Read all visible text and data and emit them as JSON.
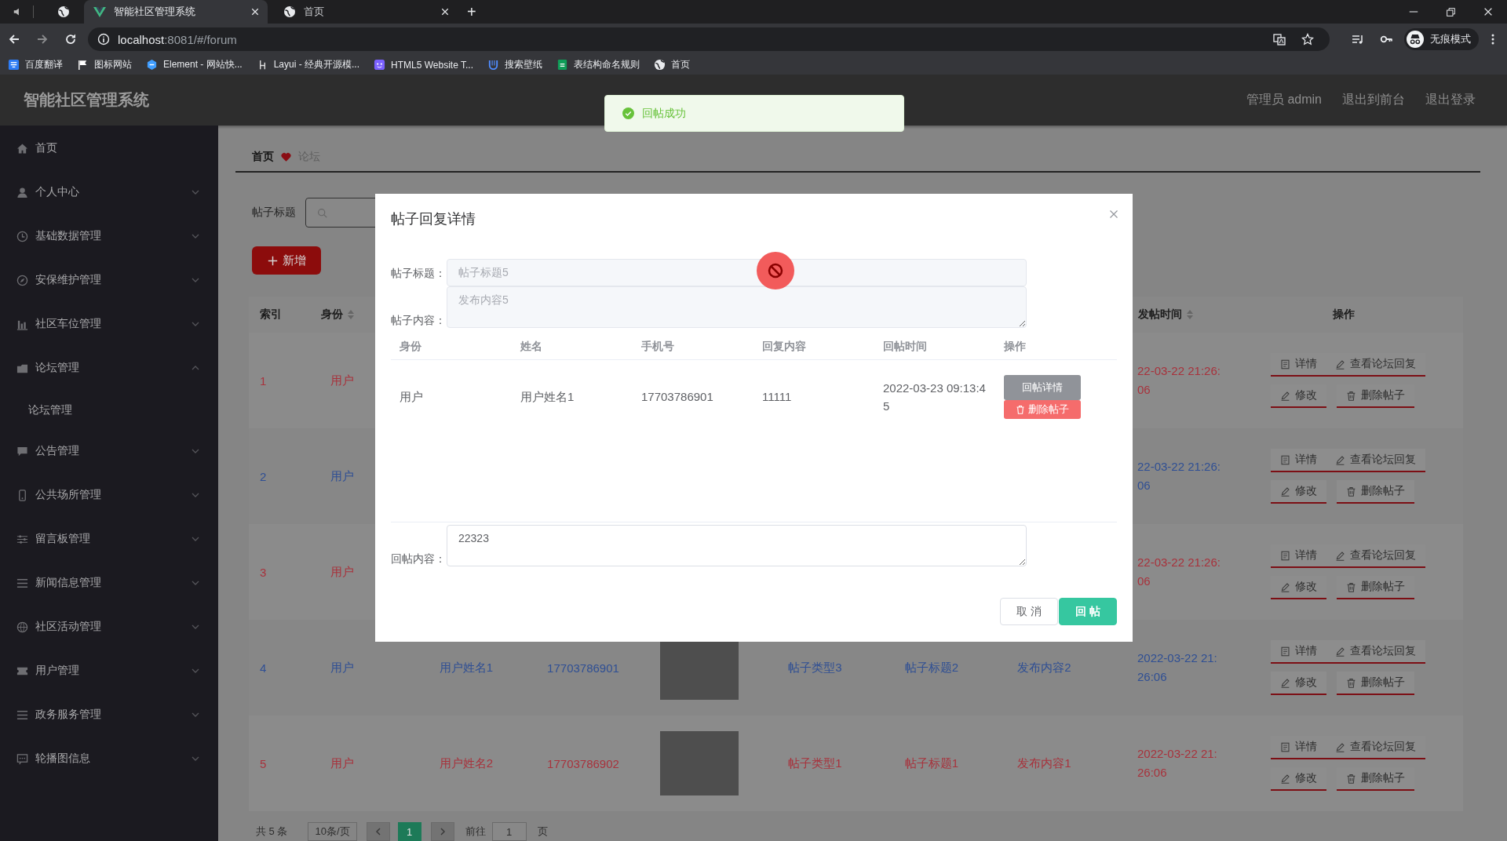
{
  "browser": {
    "tabs": [
      {
        "title": "智能社区管理系统",
        "selected": true
      },
      {
        "title": "首页",
        "selected": false
      }
    ],
    "new_tab": "+",
    "url": {
      "host": "localhost",
      "path": ":8081/#/forum"
    },
    "profile": "无痕模式",
    "bookmarks": [
      "百度翻译",
      "图标网站",
      "Element - 网站快...",
      "Layui - 经典开源模...",
      "HTML5 Website T...",
      "搜索壁纸",
      "表结构命名规则",
      "首页"
    ]
  },
  "header": {
    "title": "智能社区管理系统",
    "links": [
      "管理员 admin",
      "退出到前台",
      "退出登录"
    ]
  },
  "toast": {
    "message": "回帖成功"
  },
  "sidebar": {
    "items": [
      {
        "label": "首页"
      },
      {
        "label": "个人中心",
        "expanded": false
      },
      {
        "label": "基础数据管理",
        "expanded": false
      },
      {
        "label": "安保维护管理",
        "expanded": false
      },
      {
        "label": "社区车位管理",
        "expanded": false
      },
      {
        "label": "论坛管理",
        "expanded": true,
        "children": [
          {
            "label": "论坛管理"
          }
        ]
      },
      {
        "label": "公告管理",
        "expanded": false
      },
      {
        "label": "公共场所管理",
        "expanded": false
      },
      {
        "label": "留言板管理",
        "expanded": false
      },
      {
        "label": "新闻信息管理",
        "expanded": false
      },
      {
        "label": "社区活动管理",
        "expanded": false
      },
      {
        "label": "用户管理",
        "expanded": false
      },
      {
        "label": "政务服务管理",
        "expanded": false
      },
      {
        "label": "轮播图信息",
        "expanded": false
      }
    ]
  },
  "breadcrumb": [
    "首页",
    "论坛"
  ],
  "search": {
    "label": "帖子标题"
  },
  "add_button": "新增",
  "table": {
    "columns": {
      "index": {
        "label": "索引",
        "sortable": false
      },
      "identity": {
        "label": "身份",
        "sortable": true
      },
      "time": {
        "label": "发帖时间",
        "sortable": true
      },
      "actions": {
        "label": "操作",
        "sortable": false
      }
    },
    "rows": [
      {
        "color": "#a8323c",
        "index": "1",
        "identity": "用户",
        "time": "22-03-22 21:26:06",
        "actions": [
          {
            "label": "详情",
            "kind": "detail"
          },
          {
            "label": "查看论坛回复",
            "kind": "replies"
          },
          {
            "label": "修改",
            "kind": "edit"
          },
          {
            "label": "删除帖子",
            "kind": "delete"
          }
        ]
      },
      {
        "color": "#2f4f94",
        "index": "2",
        "identity": "用户",
        "time": "22-03-22 21:26:06",
        "actions": [
          {
            "label": "详情",
            "kind": "detail"
          },
          {
            "label": "查看论坛回复",
            "kind": "replies"
          },
          {
            "label": "修改",
            "kind": "edit"
          },
          {
            "label": "删除帖子",
            "kind": "delete"
          }
        ]
      },
      {
        "color": "#a8323c",
        "index": "3",
        "identity": "用户",
        "time": "22-03-22 21:26:06",
        "actions": [
          {
            "label": "详情",
            "kind": "detail"
          },
          {
            "label": "查看论坛回复",
            "kind": "replies"
          },
          {
            "label": "修改",
            "kind": "edit"
          },
          {
            "label": "删除帖子",
            "kind": "delete"
          }
        ]
      },
      {
        "color": "#2f4f94",
        "index": "4",
        "identity": "用户",
        "name": "用户姓名1",
        "phone": "17703786901",
        "photo": true,
        "post_type": "帖子类型3",
        "post_title": "帖子标题2",
        "post_content": "发布内容2",
        "time": "2022-03-22 21:26:06",
        "actions": [
          {
            "label": "详情",
            "kind": "detail"
          },
          {
            "label": "查看论坛回复",
            "kind": "replies"
          },
          {
            "label": "修改",
            "kind": "edit"
          },
          {
            "label": "删除帖子",
            "kind": "delete"
          }
        ]
      },
      {
        "color": "#a8323c",
        "index": "5",
        "identity": "用户",
        "name": "用户姓名2",
        "phone": "17703786902",
        "photo": true,
        "post_type": "帖子类型1",
        "post_title": "帖子标题1",
        "post_content": "发布内容1",
        "time": "2022-03-22 21:26:06",
        "actions": [
          {
            "label": "详情",
            "kind": "detail"
          },
          {
            "label": "查看论坛回复",
            "kind": "replies"
          },
          {
            "label": "修改",
            "kind": "edit"
          },
          {
            "label": "删除帖子",
            "kind": "delete"
          }
        ]
      }
    ]
  },
  "pagination": {
    "total": "共 5 条",
    "page_size": "10条/页",
    "pages": [
      {
        "label": "1",
        "selected": true
      }
    ],
    "goto": "前往",
    "goto_value": "1",
    "page_unit": "页"
  },
  "modal": {
    "title": "帖子回复详情",
    "fields": [
      {
        "label": "帖子标题：",
        "value": "帖子标题5",
        "kind": "input",
        "disabled": true
      },
      {
        "label": "帖子内容：",
        "value": "发布内容5",
        "kind": "textarea",
        "disabled": true
      }
    ],
    "replies": {
      "columns": [
        "身份",
        "姓名",
        "手机号",
        "回复内容",
        "回帖时间",
        "操作"
      ],
      "rows": [
        {
          "identity": "用户",
          "name": "用户姓名1",
          "phone": "17703786901",
          "content": "11111",
          "time": "2022-03-23 09:13:45",
          "actions": [
            {
              "label": "回帖详情",
              "kind": "reply-detail"
            },
            {
              "label": "删除帖子",
              "kind": "delete"
            }
          ]
        }
      ]
    },
    "reply_field": {
      "label": "回帖内容：",
      "value": "22323"
    },
    "buttons": [
      {
        "label": "取 消",
        "kind": "cancel"
      },
      {
        "label": "回 帖",
        "kind": "primary"
      }
    ]
  }
}
